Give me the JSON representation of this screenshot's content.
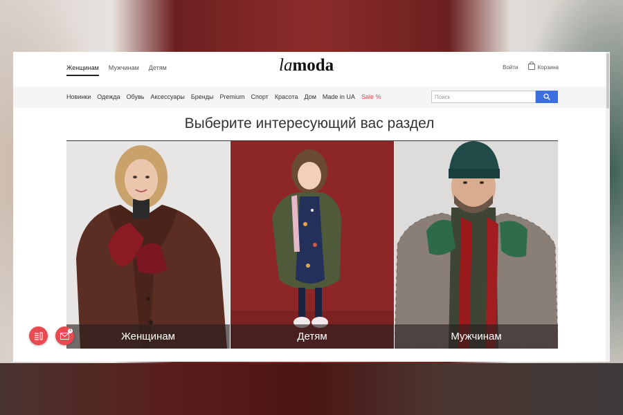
{
  "header": {
    "gender_tabs": [
      "Женщинам",
      "Мужчинам",
      "Детям"
    ],
    "active_gender": "Женщинам",
    "logo": {
      "part1": "la",
      "part2": "moda"
    },
    "login": "Войти",
    "cart": "Корзина"
  },
  "categories": [
    "Новинки",
    "Одежда",
    "Обувь",
    "Аксессуары",
    "Бренды",
    "Premium",
    "Спорт",
    "Красота",
    "Дом",
    "Made in UA",
    "Sale %"
  ],
  "search": {
    "placeholder": "Поиск",
    "value": "",
    "icon": "search-icon"
  },
  "main": {
    "heading": "Выберите интересующий вас раздел",
    "sections": [
      {
        "label": "Женщинам"
      },
      {
        "label": "Детям"
      },
      {
        "label": "Мужчинам"
      }
    ]
  },
  "floating": {
    "badge": "1"
  },
  "colors": {
    "accent": "#e84a52",
    "search_button": "#3b6fe0",
    "sale": "#e0474f"
  }
}
